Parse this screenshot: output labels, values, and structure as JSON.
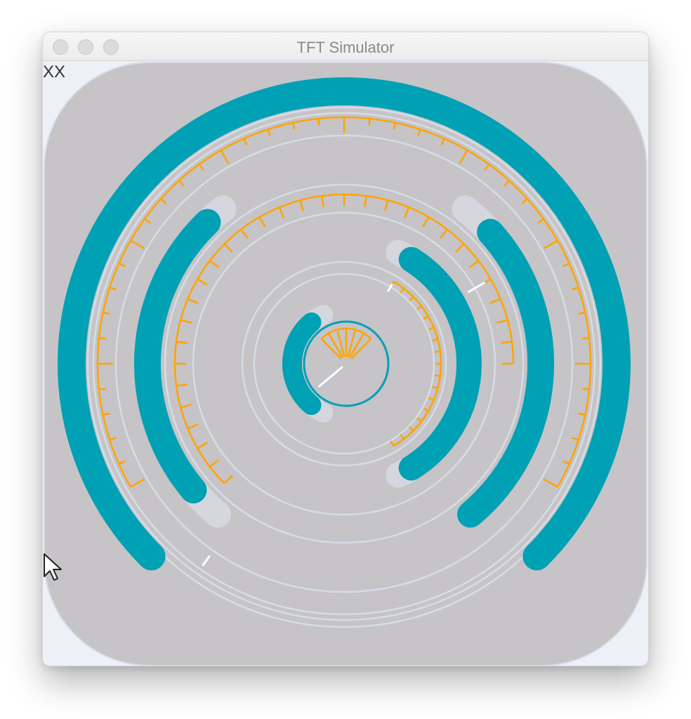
{
  "window": {
    "title": "TFT Simulator"
  },
  "screen": {
    "corner_label": "XX"
  },
  "colors": {
    "panel_bg": "#c6c4c7",
    "arc_active": "#00a0b5",
    "arc_track": "#d6d6de",
    "ring_outline": "#d5dde7",
    "scale_ticks": "#ffa400",
    "needle": "#ffffff"
  },
  "widgets": {
    "arcs": [
      "outer-arc",
      "left-arc",
      "right-arc",
      "right-inner-arc",
      "small-left-arc"
    ],
    "scales": [
      "outer-scale",
      "middle-scale",
      "right-scale",
      "center-scale"
    ]
  }
}
